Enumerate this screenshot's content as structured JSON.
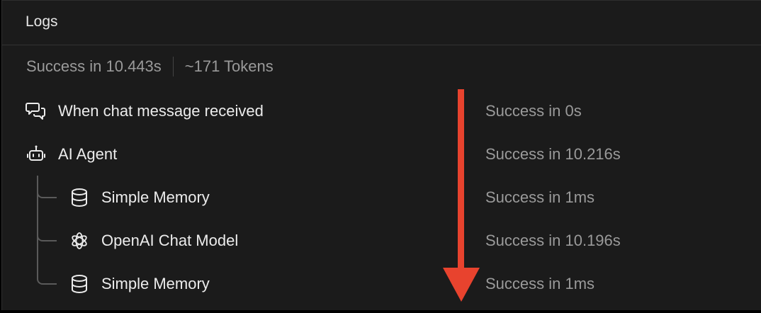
{
  "header": {
    "title": "Logs"
  },
  "summary": {
    "status": "Success in 10.443s",
    "tokens": "~171 Tokens"
  },
  "rows": [
    {
      "label": "When chat message received",
      "status": "Success in 0s",
      "icon": "chat-icon"
    },
    {
      "label": "AI Agent",
      "status": "Success in 10.216s",
      "icon": "robot-icon"
    },
    {
      "label": "Simple Memory",
      "status": "Success in 1ms",
      "icon": "database-icon"
    },
    {
      "label": "OpenAI Chat Model",
      "status": "Success in 10.196s",
      "icon": "openai-icon"
    },
    {
      "label": "Simple Memory",
      "status": "Success in 1ms",
      "icon": "database-icon"
    }
  ],
  "colors": {
    "background": "#1b1b1b",
    "text": "#ececec",
    "muted": "#9a9a9a",
    "arrow": "#e8432e"
  }
}
